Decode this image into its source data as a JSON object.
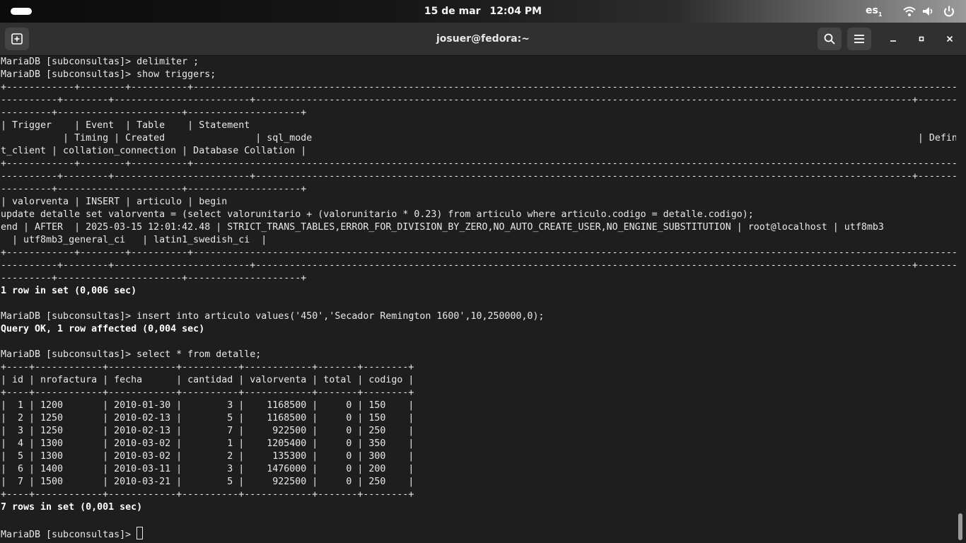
{
  "topbar": {
    "date": "15 de mar",
    "time": "12:04 PM",
    "lang": "es",
    "lang_sub": "1"
  },
  "window": {
    "title": "josuer@fedora:~"
  },
  "terminal": {
    "lines": [
      "MariaDB [subconsultas]> delimiter ;",
      "MariaDB [subconsultas]> show triggers;",
      "+------------+--------+----------+-------------------------------------------------------------------------------------------------------------------------------------------------------------------------------------",
      "----------+--------+------------------------+--------------------------------------------------------------------------------------------------------------------+----------------+----------",
      "---------+----------------------+--------------------+",
      "| Trigger    | Event  | Table    | Statement",
      "           | Timing | Created                | sql_mode                                                                                                           | Definer        | character_se",
      "t_client | collation_connection | Database Collation |",
      "+------------+--------+----------+-------------------------------------------------------------------------------------------------------------------------------------------------------------------------------------",
      "----------+--------+------------------------+--------------------------------------------------------------------------------------------------------------------+----------------+----------",
      "---------+----------------------+--------------------+",
      "| valorventa | INSERT | articulo | begin",
      "update detalle set valorventa = (select valorunitario + (valorunitario * 0.23) from articulo where articulo.codigo = detalle.codigo);",
      "end | AFTER  | 2025-03-15 12:01:42.48 | STRICT_TRANS_TABLES,ERROR_FOR_DIVISION_BY_ZERO,NO_AUTO_CREATE_USER,NO_ENGINE_SUBSTITUTION | root@localhost | utf8mb3",
      "  | utf8mb3_general_ci   | latin1_swedish_ci  |",
      "+------------+--------+----------+-------------------------------------------------------------------------------------------------------------------------------------------------------------------------------------",
      "----------+--------+------------------------+--------------------------------------------------------------------------------------------------------------------+----------------+----------",
      "---------+----------------------+--------------------+",
      "1 row in set (0,006 sec)",
      "",
      "MariaDB [subconsultas]> insert into articulo values('450','Secador Remington 1600',10,250000,0);",
      "Query OK, 1 row affected (0,004 sec)",
      "",
      "MariaDB [subconsultas]> select * from detalle;",
      "+----+------------+------------+----------+------------+-------+--------+",
      "| id | nrofactura | fecha      | cantidad | valorventa | total | codigo |",
      "+----+------------+------------+----------+------------+-------+--------+",
      "|  1 | 1200       | 2010-01-30 |        3 |    1168500 |     0 | 150    |",
      "|  2 | 1250       | 2010-02-13 |        5 |    1168500 |     0 | 150    |",
      "|  3 | 1250       | 2010-02-13 |        7 |     922500 |     0 | 250    |",
      "|  4 | 1300       | 2010-03-02 |        1 |    1205400 |     0 | 350    |",
      "|  5 | 1300       | 2010-03-02 |        2 |     135300 |     0 | 300    |",
      "|  6 | 1400       | 2010-03-11 |        3 |    1476000 |     0 | 200    |",
      "|  7 | 1500       | 2010-03-21 |        5 |     922500 |     0 | 250    |",
      "+----+------------+------------+----------+------------+-------+--------+",
      "7 rows in set (0,001 sec)",
      ""
    ],
    "bold_lines": [
      18,
      21,
      35
    ],
    "prompt": "MariaDB [subconsultas]> "
  }
}
